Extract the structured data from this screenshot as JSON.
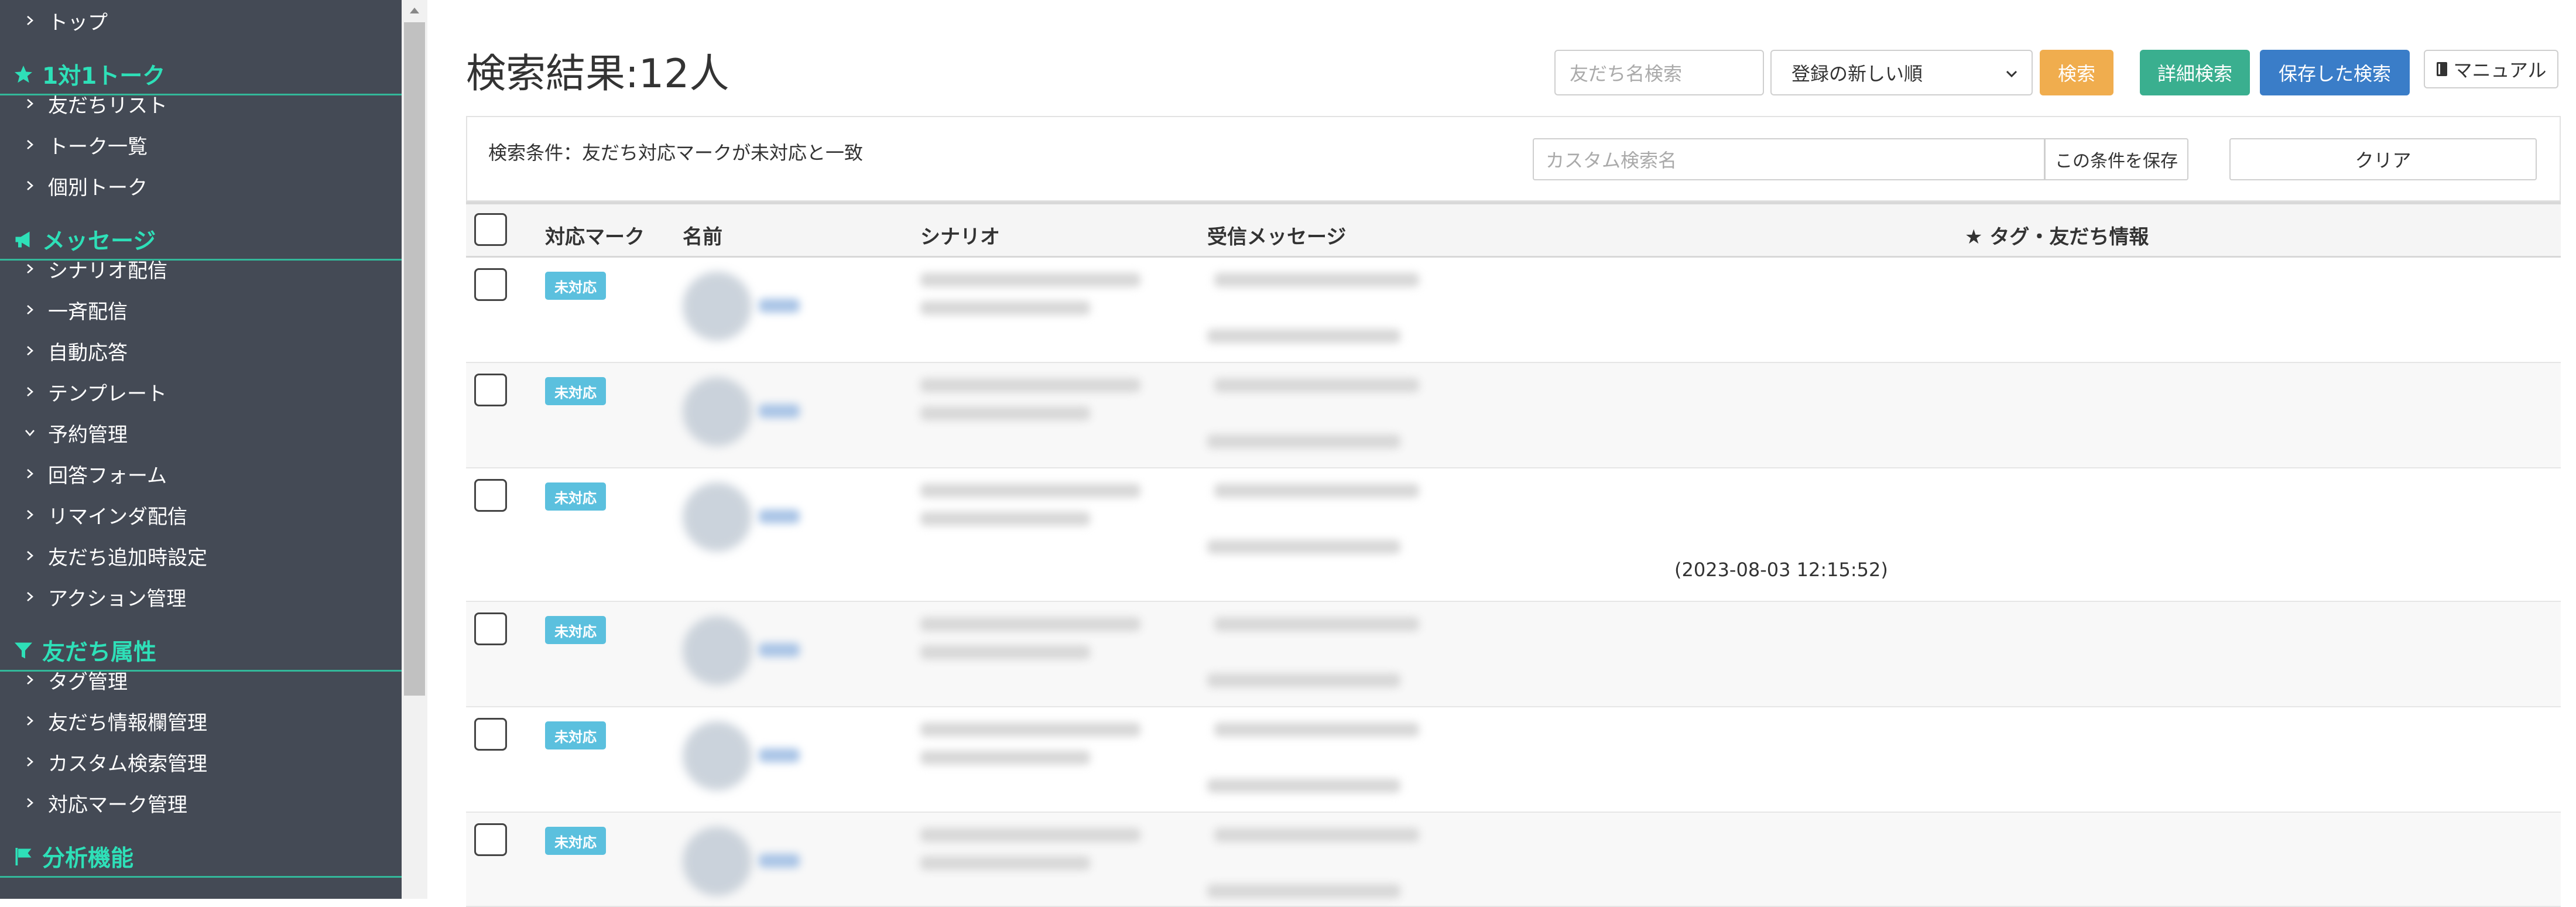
{
  "sidebar": {
    "items": [
      {
        "type": "item",
        "label": "トップ",
        "chevron": "right"
      },
      {
        "type": "heading",
        "label": "1対1トーク",
        "icon": "star-icon"
      },
      {
        "type": "item",
        "label": "友だちリスト",
        "chevron": "right"
      },
      {
        "type": "item",
        "label": "トーク一覧",
        "chevron": "right"
      },
      {
        "type": "item",
        "label": "個別トーク",
        "chevron": "right"
      },
      {
        "type": "heading",
        "label": "メッセージ",
        "icon": "megaphone-icon"
      },
      {
        "type": "item",
        "label": "シナリオ配信",
        "chevron": "right"
      },
      {
        "type": "item",
        "label": "一斉配信",
        "chevron": "right"
      },
      {
        "type": "item",
        "label": "自動応答",
        "chevron": "right"
      },
      {
        "type": "item",
        "label": "テンプレート",
        "chevron": "right"
      },
      {
        "type": "item",
        "label": "予約管理",
        "chevron": "down"
      },
      {
        "type": "item",
        "label": "回答フォーム",
        "chevron": "right"
      },
      {
        "type": "item",
        "label": "リマインダ配信",
        "chevron": "right"
      },
      {
        "type": "item",
        "label": "友だち追加時設定",
        "chevron": "right"
      },
      {
        "type": "item",
        "label": "アクション管理",
        "chevron": "right"
      },
      {
        "type": "heading",
        "label": "友だち属性",
        "icon": "filter-icon"
      },
      {
        "type": "item",
        "label": "タグ管理",
        "chevron": "right"
      },
      {
        "type": "item",
        "label": "友だち情報欄管理",
        "chevron": "right"
      },
      {
        "type": "item",
        "label": "カスタム検索管理",
        "chevron": "right"
      },
      {
        "type": "item",
        "label": "対応マーク管理",
        "chevron": "right"
      },
      {
        "type": "heading",
        "label": "分析機能",
        "icon": "flag-icon"
      }
    ]
  },
  "header": {
    "title": "検索結果:12人",
    "friend_search_placeholder": "友だち名検索",
    "sort_selected": "登録の新しい順",
    "search_label": "検索",
    "detail_search_label": "詳細検索",
    "saved_search_label": "保存した検索",
    "manual_label": "マニュアル"
  },
  "condition": {
    "text": "検索条件：友だち対応マークが未対応と一致",
    "custom_name_placeholder": "カスタム検索名",
    "save_condition_label": "この条件を保存",
    "clear_label": "クリア"
  },
  "table": {
    "columns": [
      "対応マーク",
      "名前",
      "シナリオ",
      "受信メッセージ",
      "★ タグ・友だち情報"
    ],
    "rows": [
      {
        "mark": "未対応",
        "visible_timestamp": ""
      },
      {
        "mark": "未対応",
        "visible_timestamp": ""
      },
      {
        "mark": "未対応",
        "visible_timestamp": "(2023-08-03 12:15:52)"
      },
      {
        "mark": "未対応",
        "visible_timestamp": ""
      },
      {
        "mark": "未対応",
        "visible_timestamp": ""
      },
      {
        "mark": "未対応",
        "visible_timestamp": ""
      }
    ]
  },
  "colors": {
    "sidebar_bg": "#444a55",
    "sidebar_heading": "#2ee0b8",
    "badge": "#5bc0de",
    "search_btn": "#f0ad4e",
    "detail_btn": "#3aaf8f",
    "saved_btn": "#3a7dc8"
  }
}
